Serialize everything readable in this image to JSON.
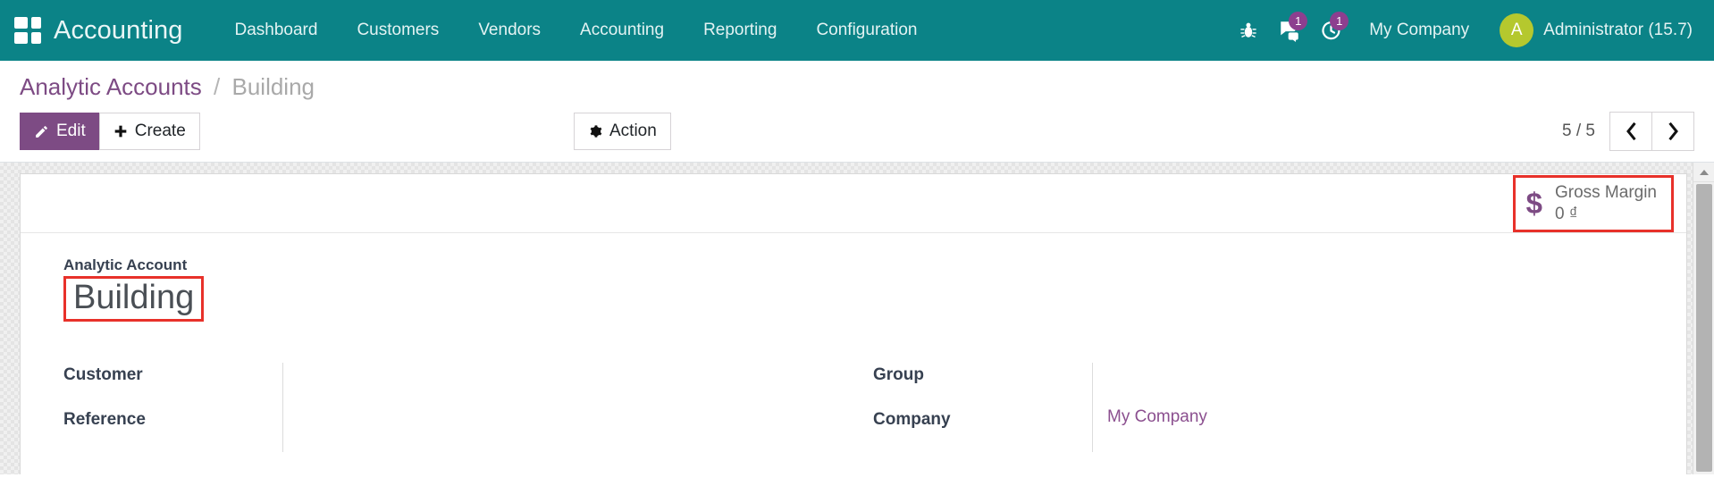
{
  "navbar": {
    "apps_icon": "apps-grid-icon",
    "brand": "Accounting",
    "menu_items": [
      {
        "label": "Dashboard"
      },
      {
        "label": "Customers"
      },
      {
        "label": "Vendors"
      },
      {
        "label": "Accounting"
      },
      {
        "label": "Reporting"
      },
      {
        "label": "Configuration"
      }
    ],
    "debug_icon": "bug-icon",
    "messages": {
      "icon": "chat-bubble-icon",
      "badge": "1"
    },
    "activities": {
      "icon": "clock-activity-icon",
      "badge": "1"
    },
    "company": "My Company",
    "user": {
      "initial": "A",
      "name": "Administrator (15.7)",
      "avatar_color": "#b5c82e"
    },
    "background_color": "#0b8387"
  },
  "control_panel": {
    "breadcrumb": {
      "parent": "Analytic Accounts",
      "separator": "/",
      "current": "Building"
    },
    "edit_label": "Edit",
    "edit_icon": "pencil-icon",
    "create_label": "Create",
    "create_icon": "plus-icon",
    "action_label": "Action",
    "action_icon": "gear-icon",
    "pager": {
      "count": "5 / 5",
      "prev_icon": "chevron-left-icon",
      "next_icon": "chevron-right-icon"
    }
  },
  "form": {
    "stat_button": {
      "icon": "dollar-sign-icon",
      "label": "Gross Margin",
      "value": "0 ₫",
      "highlight_color": "#e8312a"
    },
    "title_label": "Analytic Account",
    "title_value": "Building",
    "title_highlight_color": "#e8312a",
    "left_fields": [
      {
        "label": "Customer",
        "value": ""
      },
      {
        "label": "Reference",
        "value": ""
      }
    ],
    "right_fields": [
      {
        "label": "Group",
        "value": "",
        "is_link": false
      },
      {
        "label": "Company",
        "value": "My Company",
        "is_link": true
      }
    ]
  },
  "scrollbar": {
    "up_arrow_icon": "scroll-up-arrow-icon",
    "thumb": "scroll-thumb"
  }
}
